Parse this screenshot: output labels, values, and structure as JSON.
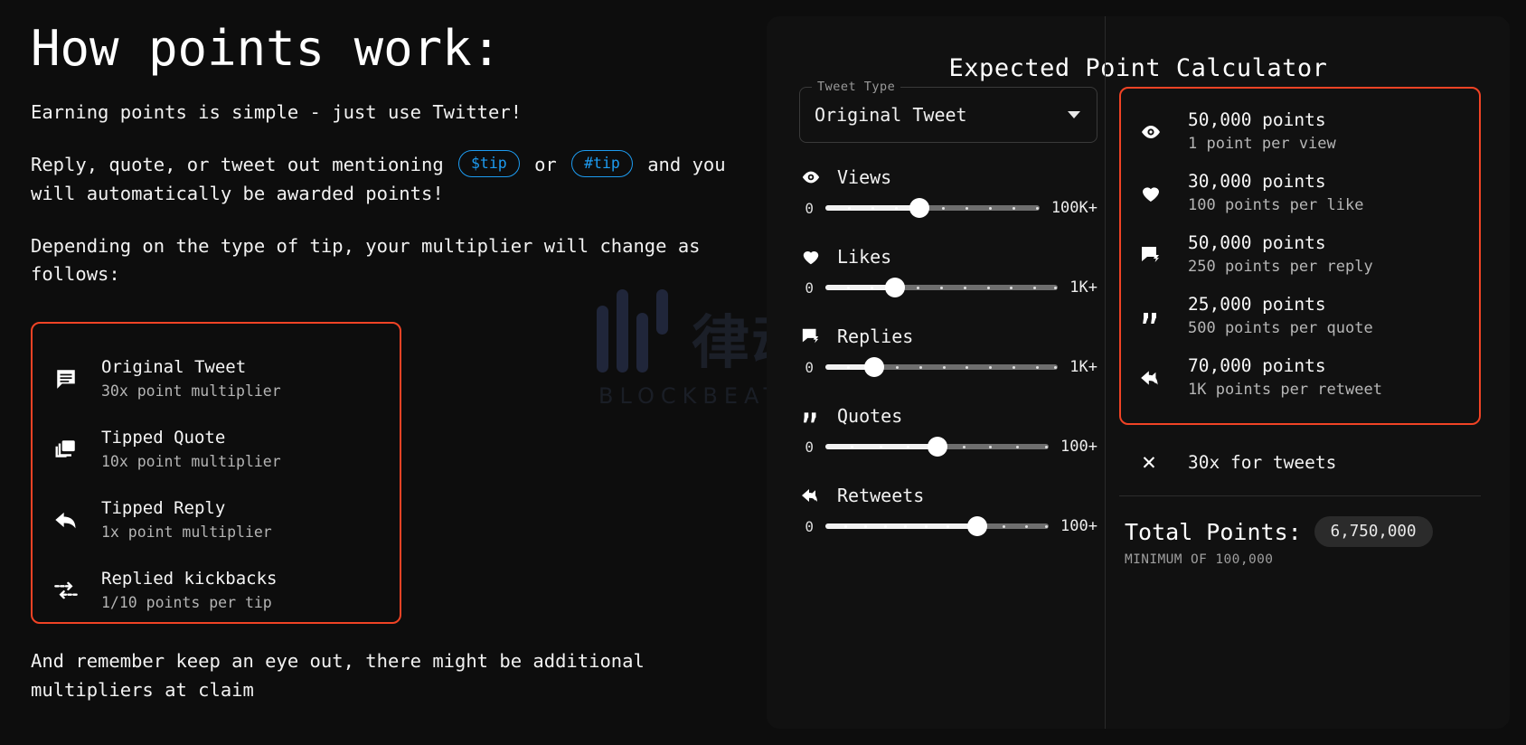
{
  "left": {
    "title": "How points work:",
    "intro": "Earning points is simple - just use Twitter!",
    "p2_before": "Reply, quote, or tweet out mentioning ",
    "chip1": "$tip",
    "p2_mid": " or ",
    "chip2": "#tip",
    "p2_after": " and you will automatically be awarded points!",
    "p3": "Depending on the type of tip, your multiplier will change as follows:",
    "closing": "And remember keep an eye out, there might be additional multipliers at claim",
    "multipliers": [
      {
        "icon": "message-icon",
        "title": "Original Tweet",
        "sub": "30x point multiplier"
      },
      {
        "icon": "copy-stack-icon",
        "title": "Tipped Quote",
        "sub": "10x point multiplier"
      },
      {
        "icon": "reply-arrow-icon",
        "title": "Tipped Reply",
        "sub": "1x point multiplier"
      },
      {
        "icon": "kickback-arrow-icon",
        "title": "Replied kickbacks",
        "sub": "1/10 points per tip"
      }
    ]
  },
  "calculator": {
    "title": "Expected Point Calculator",
    "tweet_type": {
      "legend": "Tweet Type",
      "value": "Original Tweet"
    },
    "sliders": [
      {
        "icon": "eye-icon",
        "label": "Views",
        "min": "0",
        "max": "100K+",
        "percent": 44
      },
      {
        "icon": "heart-icon",
        "label": "Likes",
        "min": "0",
        "max": "1K+",
        "percent": 30
      },
      {
        "icon": "reply-box-icon",
        "label": "Replies",
        "min": "0",
        "max": "1K+",
        "percent": 21
      },
      {
        "icon": "quote-icon",
        "label": "Quotes",
        "min": "0",
        "max": "100+",
        "percent": 50
      },
      {
        "icon": "retweet-icon",
        "label": "Retweets",
        "min": "0",
        "max": "100+",
        "percent": 68
      }
    ],
    "results": [
      {
        "icon": "eye-icon",
        "points": "50,000 points",
        "rate": "1 point per view"
      },
      {
        "icon": "heart-icon",
        "points": "30,000 points",
        "rate": "100 points per like"
      },
      {
        "icon": "reply-box-icon",
        "points": "50,000 points",
        "rate": "250 points per reply"
      },
      {
        "icon": "quote-icon",
        "points": "25,000 points",
        "rate": "500 points per quote"
      },
      {
        "icon": "retweet-icon",
        "points": "70,000 points",
        "rate": "1K points per retweet"
      }
    ],
    "multiplier_line": {
      "symbol": "✕",
      "text": "30x for tweets"
    },
    "total": {
      "label": "Total Points:",
      "value": "6,750,000",
      "minimum": "MINIMUM OF 100,000"
    }
  },
  "watermark": {
    "cn": "律动",
    "en": "BLOCKBEATS"
  },
  "colors": {
    "accent_red": "#f04325",
    "link_blue": "#1d9bf0",
    "bg": "#0d0d0d",
    "panel": "#111111"
  }
}
